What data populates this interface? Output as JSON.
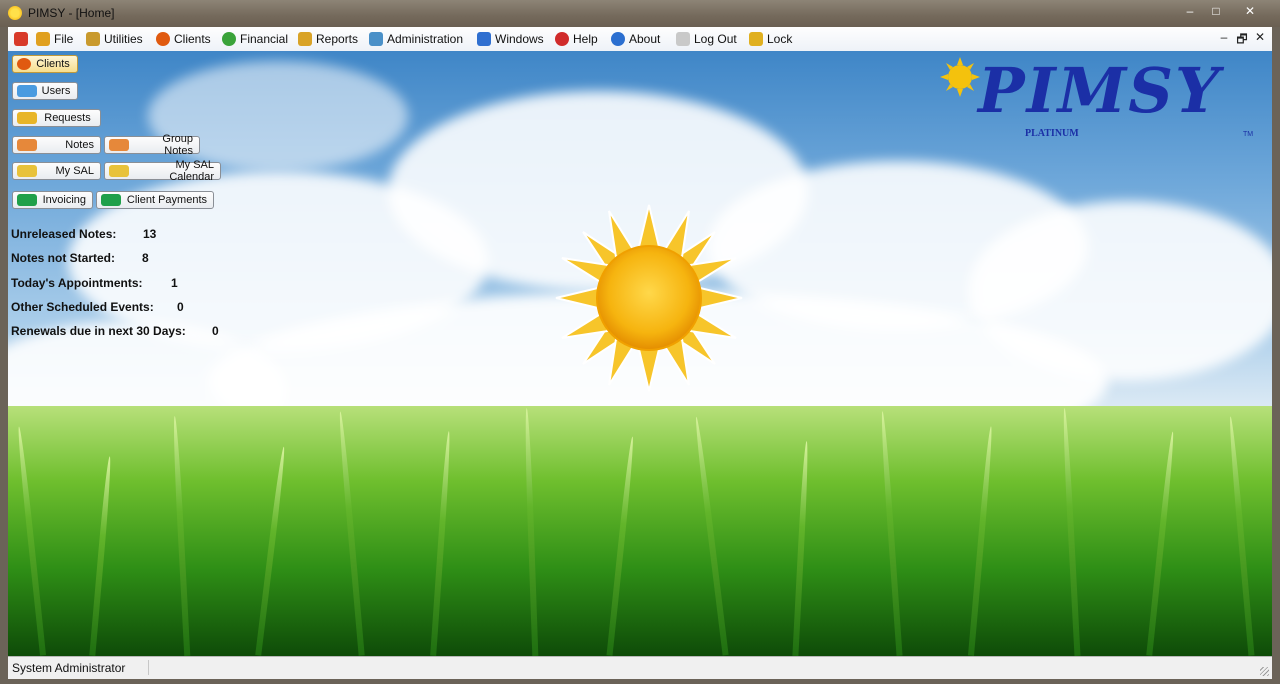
{
  "window": {
    "title": "PIMSY - [Home]",
    "controls": [
      "–",
      "□",
      "✕"
    ]
  },
  "menu": {
    "items": [
      {
        "label": "File",
        "icon": "file-icon",
        "color": "#e0a020"
      },
      {
        "label": "Utilities",
        "icon": "tools-icon",
        "color": "#c99a2e"
      },
      {
        "label": "Clients",
        "icon": "clients-icon",
        "color": "#e05a10"
      },
      {
        "label": "Financial",
        "icon": "money-icon",
        "color": "#3aa33a"
      },
      {
        "label": "Reports",
        "icon": "reports-icon",
        "color": "#d9a327"
      },
      {
        "label": "Administration",
        "icon": "admin-icon",
        "color": "#4a90c8"
      },
      {
        "label": "Windows",
        "icon": "windows-icon",
        "color": "#2f6fd0"
      },
      {
        "label": "Help",
        "icon": "help-icon",
        "color": "#d02b2b"
      },
      {
        "label": "About",
        "icon": "about-icon",
        "color": "#2b6fd0"
      },
      {
        "label": "Log Out",
        "icon": "logout-icon",
        "color": "#c9c9c9"
      },
      {
        "label": "Lock",
        "icon": "lock-icon",
        "color": "#e0b020"
      }
    ],
    "mdi_controls": [
      "–",
      "🗗",
      "✕"
    ]
  },
  "panel": {
    "clients": "Clients",
    "users": "Users",
    "requests": "Requests",
    "notes": "Notes",
    "group_notes": "Group Notes",
    "my_sal": "My SAL",
    "my_sal_calendar": "My SAL Calendar",
    "invoicing": "Invoicing",
    "client_payments": "Client Payments"
  },
  "stats": {
    "unreleased_notes_label": "Unreleased Notes:",
    "unreleased_notes_value": "13",
    "notes_not_started_label": "Notes not Started:",
    "notes_not_started_value": "8",
    "todays_appointments_label": "Today's Appointments:",
    "todays_appointments_value": "1",
    "other_events_label": "Other Scheduled Events:",
    "other_events_value": "0",
    "renewals_label": "Renewals due in next 30 Days:",
    "renewals_value": "0"
  },
  "logo": {
    "wordmark": "PIMSY",
    "edition": "PLATINUM",
    "tm": "TM",
    "color": "#1b2fa6"
  },
  "status": {
    "user": "System Administrator"
  }
}
